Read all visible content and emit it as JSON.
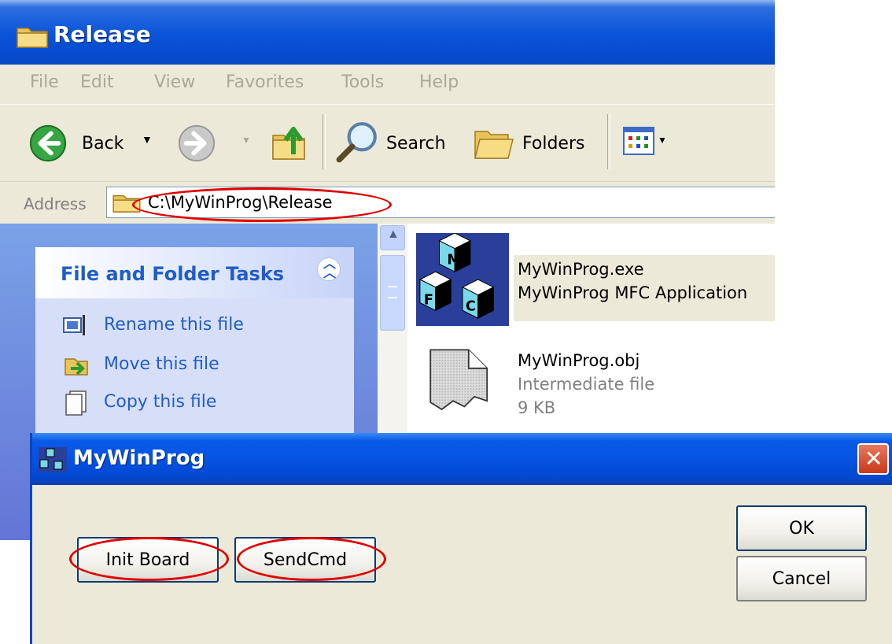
{
  "explorer": {
    "title": "Release",
    "menu": [
      "File",
      "Edit",
      "View",
      "Favorites",
      "Tools",
      "Help"
    ],
    "toolbar": {
      "back_label": "Back",
      "search_label": "Search",
      "folders_label": "Folders"
    },
    "address": {
      "label": "Address",
      "value": "C:\\MyWinProg\\Release"
    },
    "tasks": {
      "title": "File and Folder Tasks",
      "items": [
        {
          "label": "Rename this file",
          "icon": "rename-icon"
        },
        {
          "label": "Move this file",
          "icon": "move-icon"
        },
        {
          "label": "Copy this file",
          "icon": "copy-icon"
        }
      ]
    },
    "files": [
      {
        "name": "MyWinProg.exe",
        "line2": "MyWinProg MFC Application",
        "icon": "mfc-app-icon"
      },
      {
        "name": "MyWinProg.obj",
        "line2": "Intermediate file",
        "line3": "9 KB",
        "icon": "generic-file-icon"
      }
    ]
  },
  "dialog": {
    "title": "MyWinProg",
    "buttons": {
      "init_board": "Init Board",
      "send_cmd": "SendCmd",
      "ok": "OK",
      "cancel": "Cancel"
    }
  },
  "colors": {
    "xp_blue": "#0a53d8",
    "task_link": "#215dc6",
    "annotation_red": "#e00000"
  }
}
